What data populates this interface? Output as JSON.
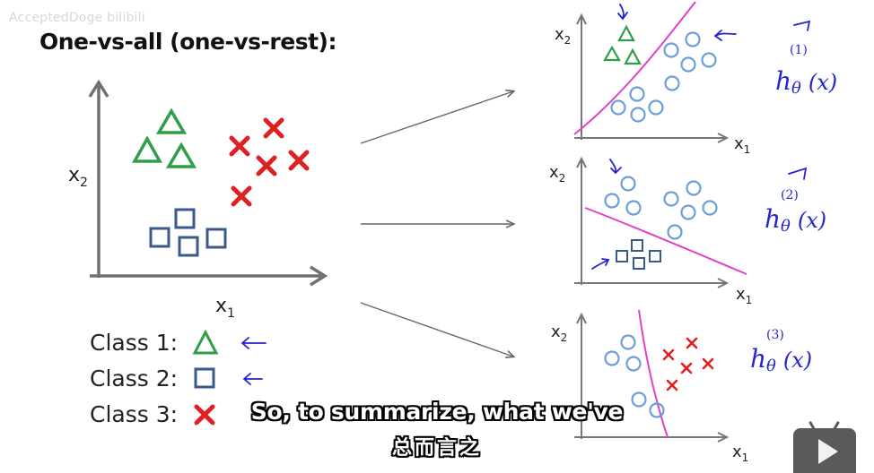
{
  "watermark": "AcceptedDoge bilibili",
  "title": "One-vs-all (one-vs-rest):",
  "main_plot": {
    "x_label": "x",
    "x_sub": "1",
    "y_label": "x",
    "y_sub": "2"
  },
  "panels": [
    {
      "x_label": "x",
      "x_sub": "1",
      "y_label": "x",
      "y_sub": "2",
      "hypothesis": "h",
      "theta": "θ",
      "superscript": "(1)",
      "arg": "(x)"
    },
    {
      "x_label": "x",
      "x_sub": "1",
      "y_label": "x",
      "y_sub": "2",
      "hypothesis": "h",
      "theta": "θ",
      "superscript": "(2)",
      "arg": "(x)"
    },
    {
      "x_label": "x",
      "x_sub": "1",
      "y_label": "x",
      "y_sub": "2",
      "hypothesis": "h",
      "theta": "θ",
      "superscript": "(3)",
      "arg": "(x)"
    }
  ],
  "legend": [
    {
      "label": "Class 1:",
      "marker": "triangle-icon"
    },
    {
      "label": "Class 2:",
      "marker": "square-icon"
    },
    {
      "label": "Class 3:",
      "marker": "cross-icon"
    }
  ],
  "subtitle": {
    "english": "So, to summarize, what we've",
    "chinese": "总而言之"
  },
  "colors": {
    "triangle": "#2e9e48",
    "square": "#3a5a8c",
    "cross": "#e02020",
    "circle": "#6a9fd8",
    "boundary": "#e040c8",
    "annotation": "#2424d0",
    "axis": "#666666"
  }
}
